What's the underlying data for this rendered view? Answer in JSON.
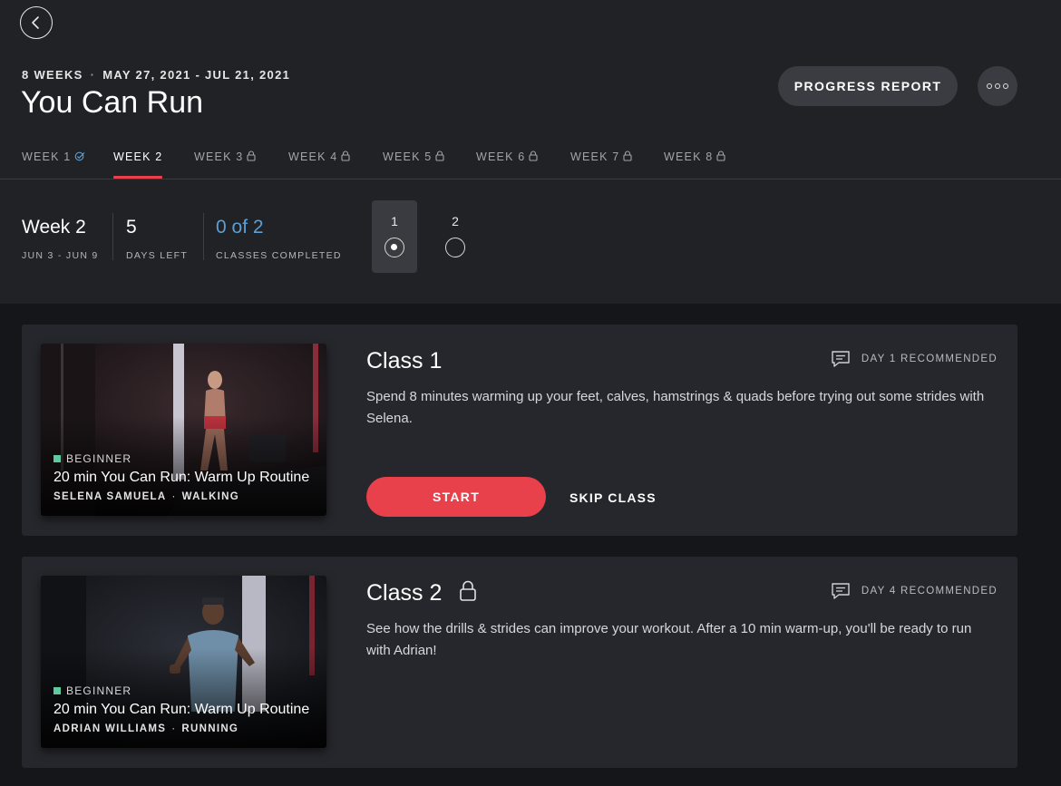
{
  "header": {
    "duration": "8 WEEKS",
    "date_range": "MAY 27, 2021 - JUL 21, 2021",
    "title": "You Can Run",
    "progress_report_label": "PROGRESS REPORT"
  },
  "tabs": [
    {
      "label": "WEEK 1",
      "state": "completed",
      "icon": "check-icon"
    },
    {
      "label": "WEEK 2",
      "state": "active",
      "icon": ""
    },
    {
      "label": "WEEK 3",
      "state": "locked",
      "icon": "lock-icon"
    },
    {
      "label": "WEEK 4",
      "state": "locked",
      "icon": "lock-icon"
    },
    {
      "label": "WEEK 5",
      "state": "locked",
      "icon": "lock-icon"
    },
    {
      "label": "WEEK 6",
      "state": "locked",
      "icon": "lock-icon"
    },
    {
      "label": "WEEK 7",
      "state": "locked",
      "icon": "lock-icon"
    },
    {
      "label": "WEEK 8",
      "state": "locked",
      "icon": "lock-icon"
    }
  ],
  "week_summary": {
    "week_label": "Week 2",
    "week_dates": "JUN 3 - JUN 9",
    "days_left_value": "5",
    "days_left_label": "DAYS LEFT",
    "classes_completed_value": "0 of 2",
    "classes_completed_label": "CLASSES COMPLETED"
  },
  "class_selector": [
    {
      "number": "1",
      "selected": true
    },
    {
      "number": "2",
      "selected": false
    }
  ],
  "classes": [
    {
      "title": "Class 1",
      "recommended": "DAY 1 RECOMMENDED",
      "description": "Spend 8 minutes warming up your feet, calves, hamstrings & quads before trying out some strides with Selena.",
      "level": "BEGINNER",
      "class_title": "20 min You Can Run: Warm Up Routine",
      "instructor": "SELENA SAMUELA",
      "type": "WALKING",
      "start_label": "START",
      "skip_label": "SKIP CLASS"
    },
    {
      "title": "Class 2",
      "recommended": "DAY 4 RECOMMENDED",
      "description": "See how the drills & strides can improve your workout. After a 10 min warm-up, you'll be ready to run with Adrian!",
      "level": "BEGINNER",
      "class_title": "20 min You Can Run: Warm Up Routine",
      "instructor": "ADRIAN WILLIAMS",
      "type": "RUNNING"
    }
  ],
  "colors": {
    "accent_red": "#e8414c",
    "progress_blue": "#5b9fd6",
    "beginner_green": "#5fc9a0"
  }
}
